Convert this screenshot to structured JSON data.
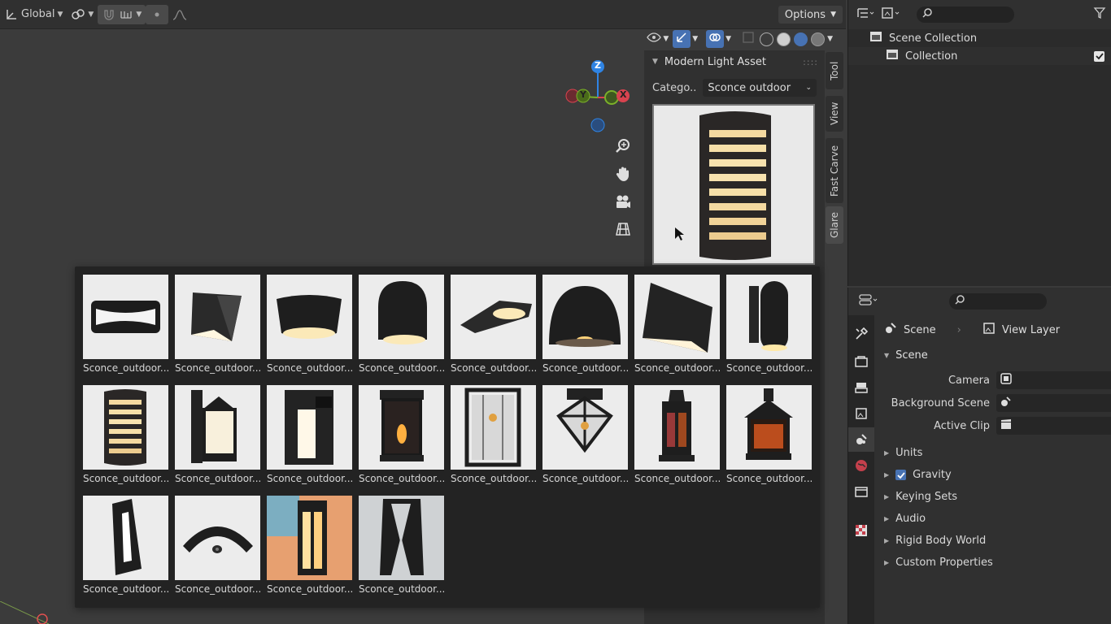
{
  "viewport": {
    "transform_orientation": "Global",
    "options_label": "Options",
    "gizmo_axes": [
      "Z",
      "Y",
      "X"
    ],
    "nav_icons": [
      "zoom-icon",
      "hand-icon",
      "camera-icon",
      "grid-icon"
    ]
  },
  "side_tabs": [
    "Tool",
    "View",
    "Fast Carve",
    "Glare"
  ],
  "npanel": {
    "title": "Modern Light Asset",
    "category_label": "Catego..",
    "category_value": "Sconce outdoor"
  },
  "assets": {
    "items": [
      "Sconce_outdoor...",
      "Sconce_outdoor...",
      "Sconce_outdoor...",
      "Sconce_outdoor...",
      "Sconce_outdoor...",
      "Sconce_outdoor...",
      "Sconce_outdoor...",
      "Sconce_outdoor...",
      "Sconce_outdoor...",
      "Sconce_outdoor...",
      "Sconce_outdoor...",
      "Sconce_outdoor...",
      "Sconce_outdoor...",
      "Sconce_outdoor...",
      "Sconce_outdoor...",
      "Sconce_outdoor...",
      "Sconce_outdoor...",
      "Sconce_outdoor...",
      "Sconce_outdoor...",
      "Sconce_outdoor..."
    ]
  },
  "outliner": {
    "scene_collection": "Scene Collection",
    "collection": "Collection"
  },
  "properties": {
    "context_scene": "Scene",
    "context_view_layer": "View Layer",
    "section_scene": "Scene",
    "camera_label": "Camera",
    "background_scene_label": "Background Scene",
    "active_clip_label": "Active Clip",
    "subsections": [
      "Units",
      "Gravity",
      "Keying Sets",
      "Audio",
      "Rigid Body World",
      "Custom Properties"
    ]
  },
  "colors": {
    "accent": "#4772b3",
    "axis_x": "#d9434f",
    "axis_y": "#7bb02a",
    "axis_z": "#2f84e4"
  }
}
